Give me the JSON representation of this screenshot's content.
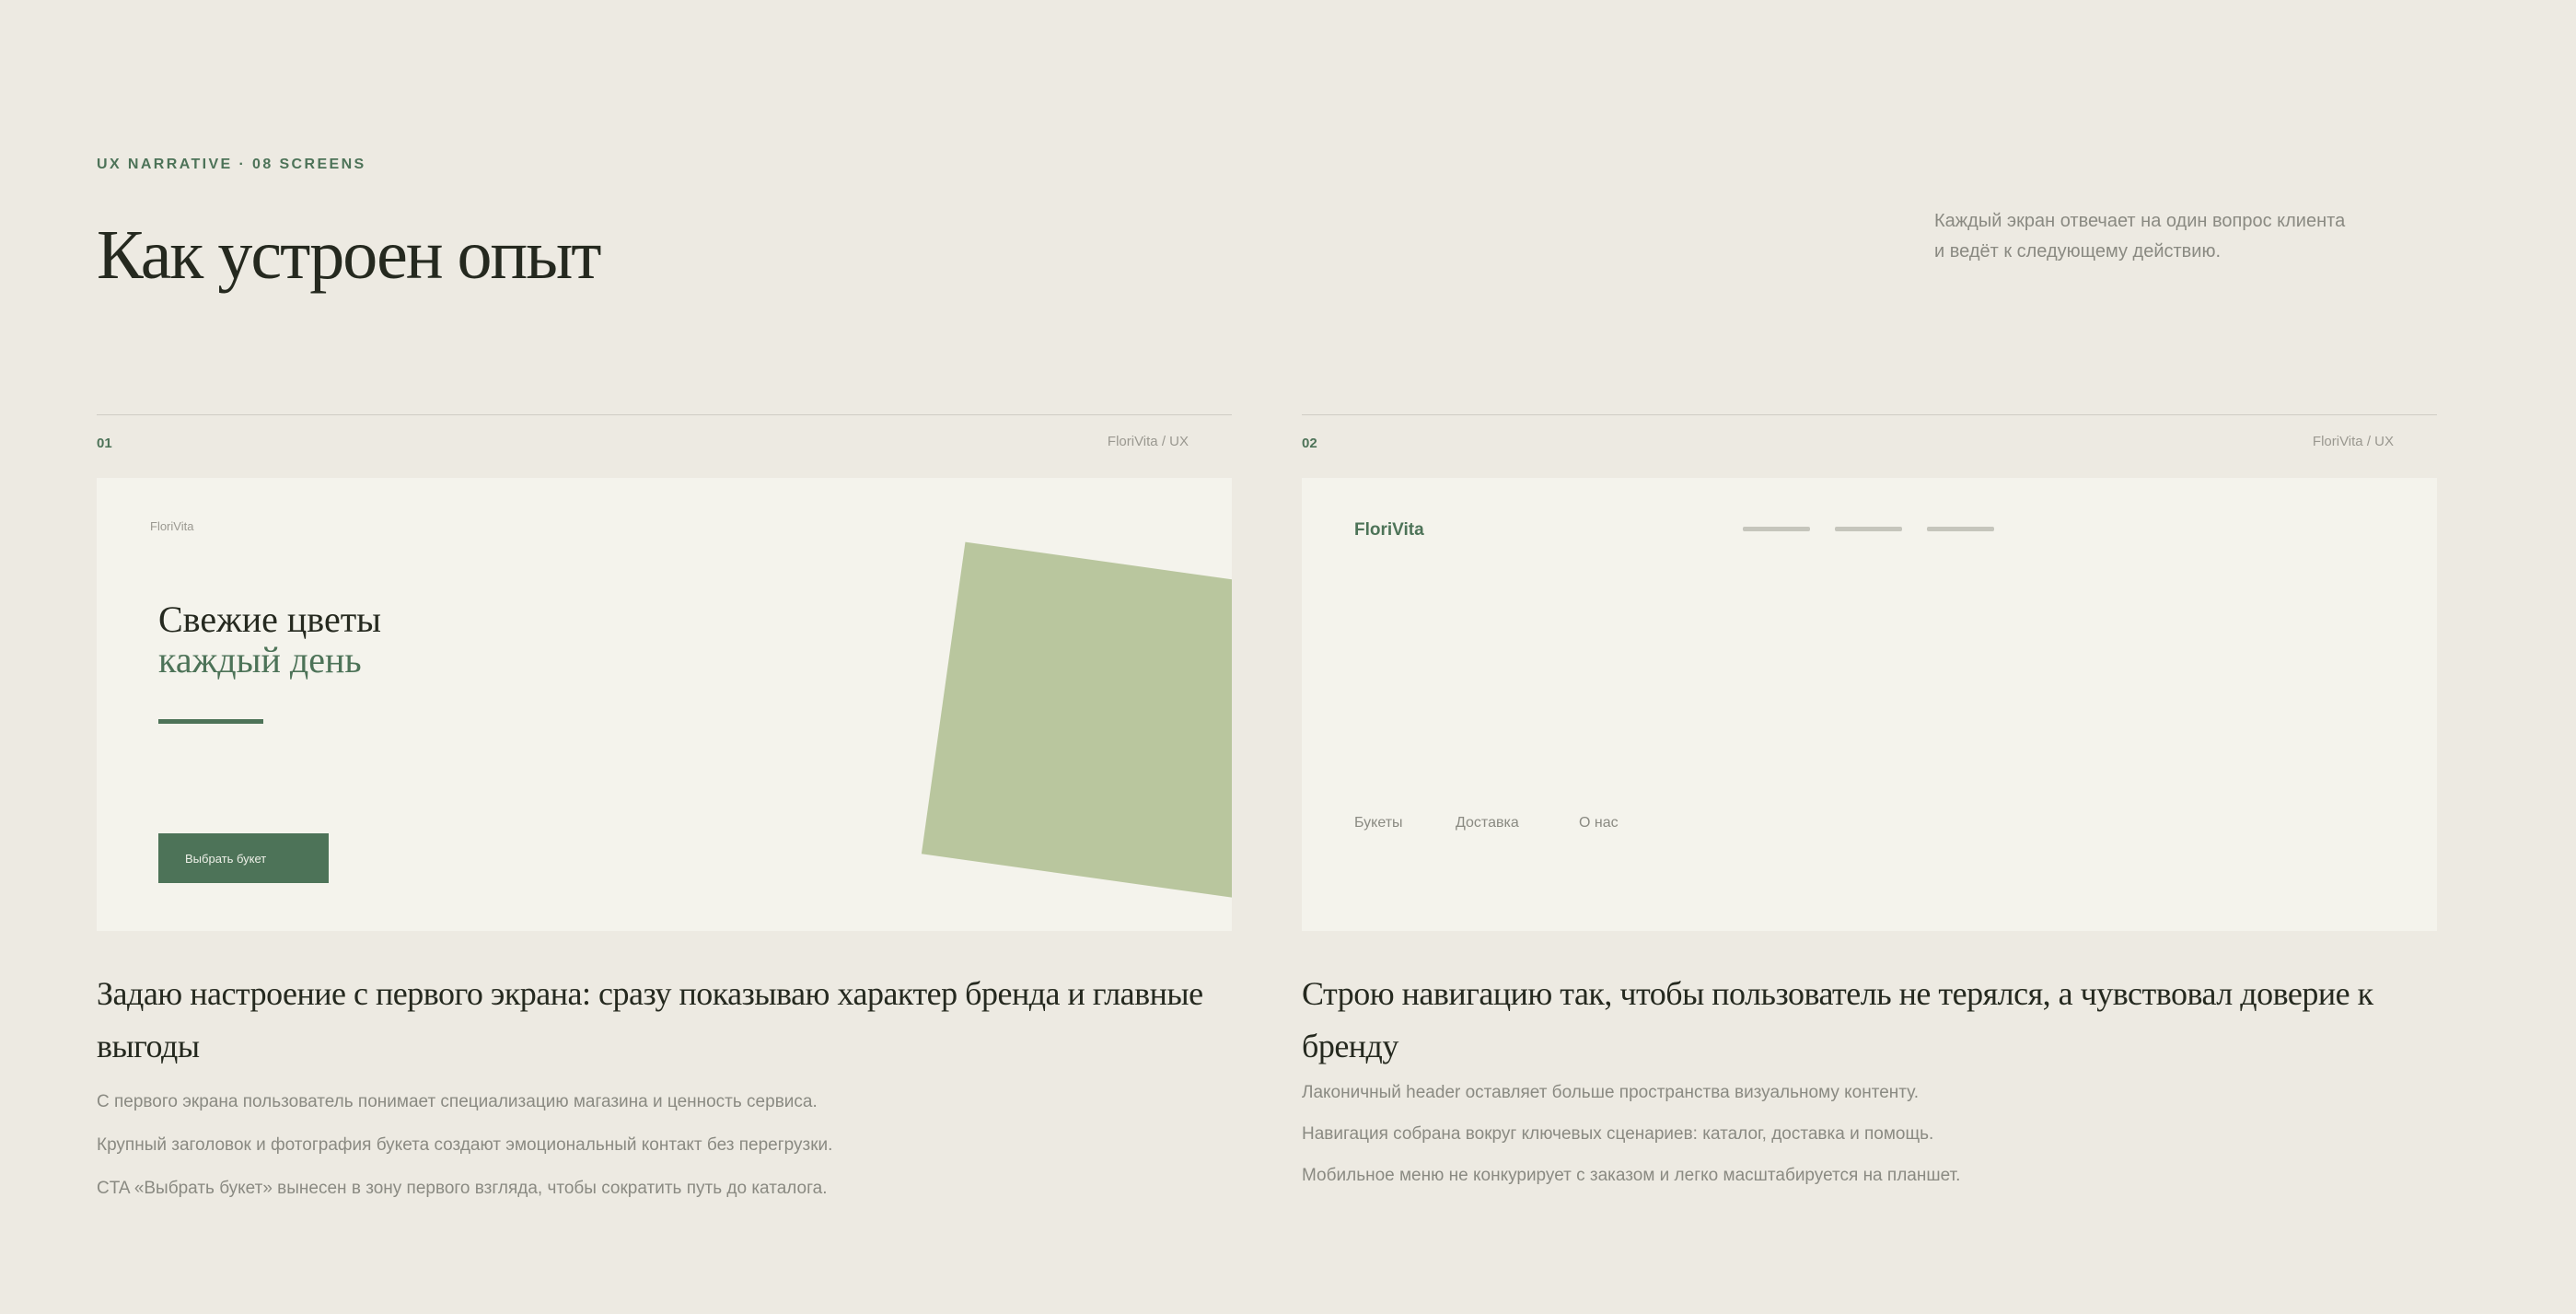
{
  "header": {
    "eyebrow": "UX NARRATIVE · 08 SCREENS",
    "title": "Как устроен опыт",
    "intro_lines": [
      "Каждый экран отвечает на один вопрос клиента",
      "и ведёт к следующему действию."
    ]
  },
  "screens": [
    {
      "number": "01",
      "tag": "FloriVita / UX",
      "mock": {
        "brand": "FloriVita",
        "headline_1": "Свежие цветы",
        "headline_2": "каждый день",
        "cta_label": "Выбрать букет"
      },
      "heading": "Задаю настроение с первого экрана: сразу показываю характер бренда и главные выгоды",
      "bullets": [
        "С первого экрана пользователь понимает специализацию магазина и ценность сервиса.",
        "Крупный заголовок и фотография букета создают эмоциональный контакт без перегрузки.",
        "CTA «Выбрать букет» вынесен в зону первого взгляда, чтобы сократить путь до каталога."
      ]
    },
    {
      "number": "02",
      "tag": "FloriVita / UX",
      "mock": {
        "brand": "FloriVita",
        "nav": [
          "Букеты",
          "Доставка",
          "О нас"
        ]
      },
      "heading": "Строю навигацию так, чтобы пользователь не терялся, а чувствовал доверие к бренду",
      "bullets": [
        "Лаконичный header оставляет больше пространства визуальному контенту.",
        "Навигация собрана вокруг ключевых сценариев: каталог, доставка и помощь.",
        "Мобильное меню не конкурирует с заказом и легко масштабируется на планшет."
      ]
    }
  ],
  "colors": {
    "background": "#edeae2",
    "card": "#f4f3ec",
    "accent": "#4d7358",
    "image_placeholder": "#b9c69e",
    "text": "#25291f",
    "muted": "#8a8a82"
  }
}
